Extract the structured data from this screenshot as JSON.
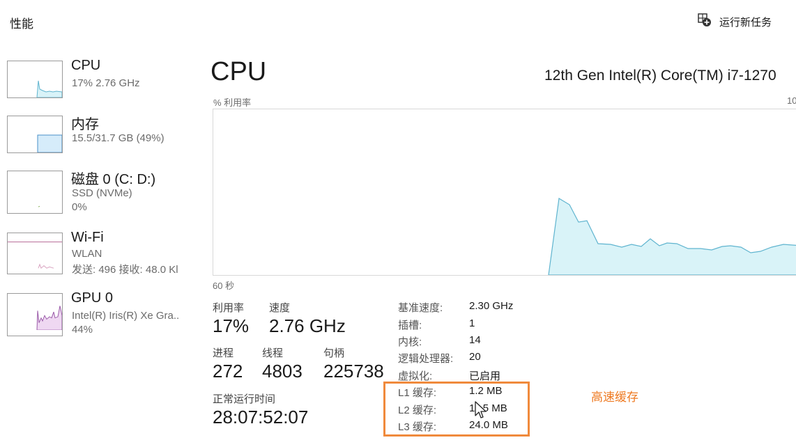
{
  "header": {
    "page_title": "性能",
    "run_task_label": "运行新任务"
  },
  "sidebar": {
    "items": [
      {
        "title": "CPU",
        "sub1": "17%  2.76 GHz",
        "sub2": ""
      },
      {
        "title": "内存",
        "sub1": "15.5/31.7 GB (49%)",
        "sub2": ""
      },
      {
        "title": "磁盘 0 (C: D:)",
        "sub1": "SSD (NVMe)",
        "sub2": "0%"
      },
      {
        "title": "Wi-Fi",
        "sub1": "WLAN",
        "sub2": "发送: 496  接收: 48.0 Kl"
      },
      {
        "title": "GPU 0",
        "sub1": "Intel(R) Iris(R) Xe Gra..",
        "sub2": "44%"
      }
    ]
  },
  "main": {
    "title": "CPU",
    "cpu_model": "12th Gen Intel(R) Core(TM) i7-1270",
    "graph_y_label": "% 利用率",
    "graph_y_max": "10",
    "graph_x_label": "60 秒",
    "stats": {
      "utilization_label": "利用率",
      "utilization_value": "17%",
      "speed_label": "速度",
      "speed_value": "2.76 GHz",
      "processes_label": "进程",
      "processes_value": "272",
      "threads_label": "线程",
      "threads_value": "4803",
      "handles_label": "句柄",
      "handles_value": "225738",
      "uptime_label": "正常运行时间",
      "uptime_value": "28:07:52:07"
    },
    "details": [
      {
        "label": "基准速度:",
        "value": "2.30 GHz"
      },
      {
        "label": "插槽:",
        "value": "1"
      },
      {
        "label": "内核:",
        "value": "14"
      },
      {
        "label": "逻辑处理器:",
        "value": "20"
      },
      {
        "label": "虚拟化:",
        "value": "已启用"
      },
      {
        "label": "L1 缓存:",
        "value": "1.2 MB"
      },
      {
        "label": "L2 缓存:",
        "value": "11.5 MB"
      },
      {
        "label": "L3 缓存:",
        "value": "24.0 MB"
      }
    ]
  },
  "annotation": {
    "text": "高速缓存",
    "color": "#ee7a22"
  },
  "colors": {
    "cpu_line": "#5fb4cf",
    "cpu_fill": "#d9f3f8",
    "mem_fill": "#d6ecfa",
    "mem_line": "#4a90c8",
    "wifi_line": "#b05c8c",
    "gpu_fill": "#efd8f2",
    "gpu_line": "#9a5aa8"
  }
}
